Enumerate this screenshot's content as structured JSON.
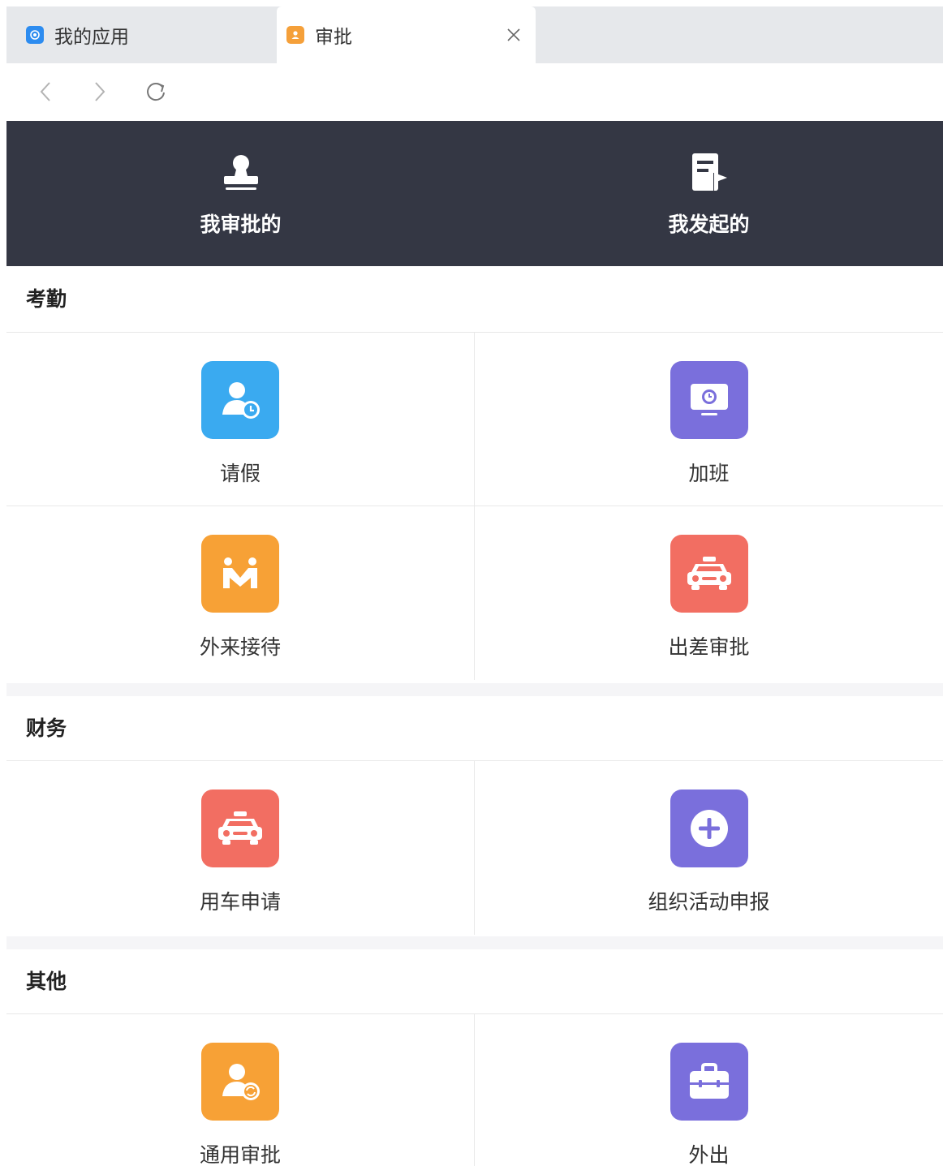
{
  "tabs": [
    {
      "label": "我的应用",
      "icon": "app-logo-icon",
      "color": "#2d8cf0",
      "active": false
    },
    {
      "label": "审批",
      "icon": "person-badge-icon",
      "color": "#f5a03a",
      "active": true
    }
  ],
  "header": {
    "items": [
      {
        "label": "我审批的",
        "icon": "stamp-icon"
      },
      {
        "label": "我发起的",
        "icon": "document-flag-icon"
      }
    ],
    "background": "#343744"
  },
  "sections": [
    {
      "title": "考勤",
      "apps": [
        {
          "label": "请假",
          "icon": "person-clock-icon",
          "color": "#3aaaf0"
        },
        {
          "label": "加班",
          "icon": "monitor-clock-icon",
          "color": "#7a6fdc"
        },
        {
          "label": "外来接待",
          "icon": "people-greeting-icon",
          "color": "#f7a136"
        },
        {
          "label": "出差审批",
          "icon": "car-icon",
          "color": "#f26e62"
        }
      ]
    },
    {
      "title": "财务",
      "apps": [
        {
          "label": "用车申请",
          "icon": "car-icon",
          "color": "#f26e62"
        },
        {
          "label": "组织活动申报",
          "icon": "plus-circle-icon",
          "color": "#7a6fdc"
        }
      ]
    },
    {
      "title": "其他",
      "apps": [
        {
          "label": "通用审批",
          "icon": "person-refresh-icon",
          "color": "#f7a136"
        },
        {
          "label": "外出",
          "icon": "briefcase-icon",
          "color": "#7a6fdc"
        }
      ]
    }
  ]
}
